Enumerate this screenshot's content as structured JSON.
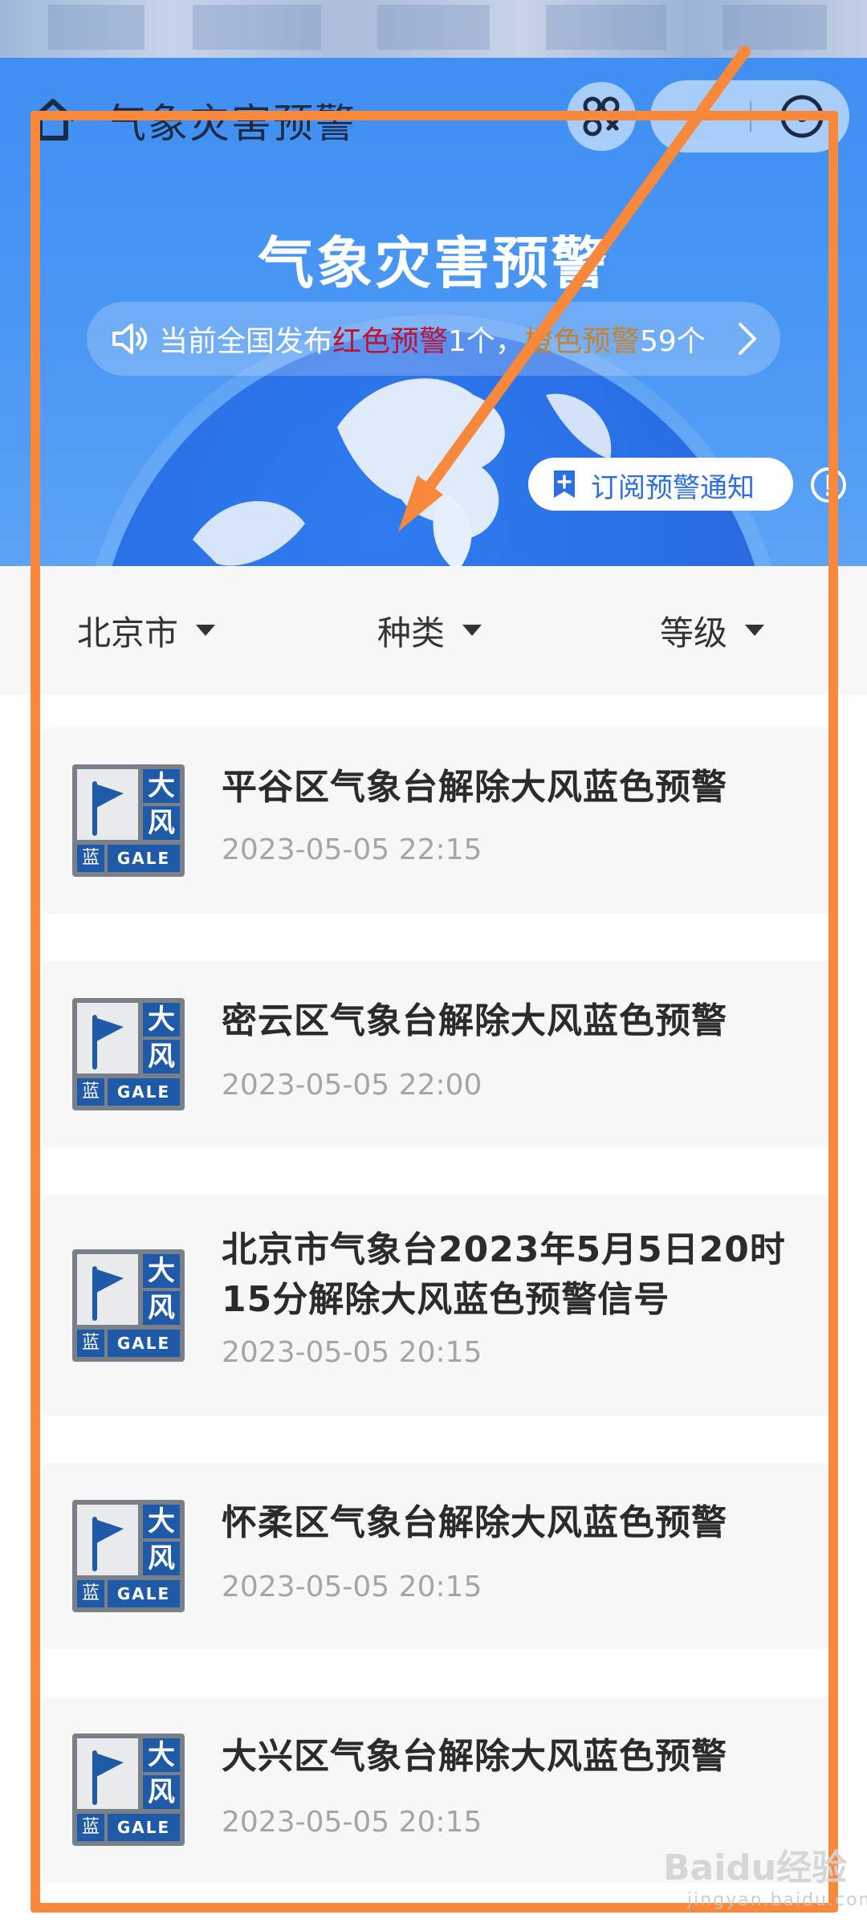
{
  "nav": {
    "title": "气象灾害预警"
  },
  "hero": {
    "title": "气象灾害预警",
    "notice": {
      "prefix": "当前全国发布",
      "red_label": "红色预警",
      "red_count": "1个，",
      "orange_label": "橙色预警",
      "orange_count": "59个"
    },
    "subscribe_label": "订阅预警通知"
  },
  "filters": {
    "city": "北京市",
    "type": "种类",
    "level": "等级"
  },
  "badge": {
    "kw1": "大",
    "kw2": "风",
    "level": "蓝",
    "en": "GALE"
  },
  "alerts": [
    {
      "title": "平谷区气象台解除大风蓝色预警",
      "time": "2023-05-05 22:15"
    },
    {
      "title": "密云区气象台解除大风蓝色预警",
      "time": "2023-05-05 22:00"
    },
    {
      "title": "北京市气象台2023年5月5日20时15分解除大风蓝色预警信号",
      "time": "2023-05-05 20:15"
    },
    {
      "title": "怀柔区气象台解除大风蓝色预警",
      "time": "2023-05-05 20:15"
    },
    {
      "title": "大兴区气象台解除大风蓝色预警",
      "time": "2023-05-05 20:15"
    }
  ],
  "watermark": {
    "main": "Baidu经验",
    "sub": "jingyan.baidu.com"
  },
  "colors": {
    "hero_blue": "#4a97f4",
    "alert_red": "#c4102f",
    "alert_orange": "#c7822a",
    "badge_blue": "#1e5aa8",
    "annotation_orange": "#f7883c"
  }
}
